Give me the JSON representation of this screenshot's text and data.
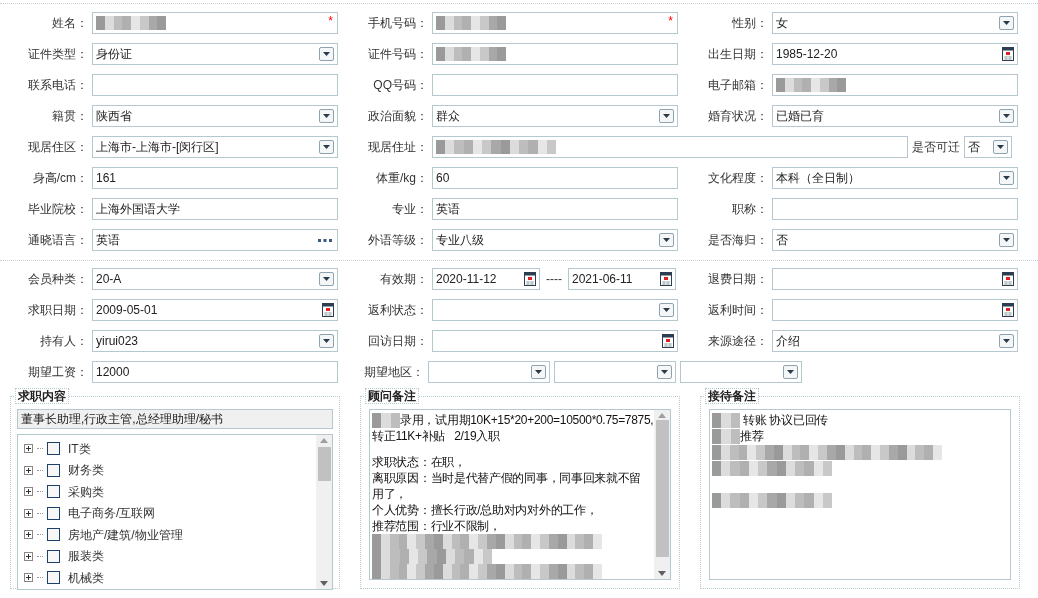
{
  "personal_rows": [
    {
      "fields": [
        {
          "label": "姓名：",
          "kind": "text",
          "required_mark": "*",
          "redacted": true
        },
        {
          "label": "手机号码：",
          "kind": "text",
          "required_mark": "*",
          "redacted": true
        },
        {
          "label": "性别：",
          "kind": "select",
          "value": "女"
        }
      ]
    },
    {
      "fields": [
        {
          "label": "证件类型：",
          "kind": "select",
          "value": "身份证"
        },
        {
          "label": "证件号码：",
          "kind": "text",
          "redacted": true
        },
        {
          "label": "出生日期：",
          "kind": "date",
          "value": "1985-12-20"
        }
      ]
    },
    {
      "fields": [
        {
          "label": "联系电话：",
          "kind": "text"
        },
        {
          "label": "QQ号码：",
          "kind": "text"
        },
        {
          "label": "电子邮箱：",
          "kind": "text",
          "redacted": true
        }
      ]
    },
    {
      "fields": [
        {
          "label": "籍贯：",
          "kind": "select",
          "value": "陕西省"
        },
        {
          "label": "政治面貌：",
          "kind": "select",
          "value": "群众"
        },
        {
          "label": "婚育状况：",
          "kind": "select",
          "value": "已婚已育"
        }
      ]
    },
    {
      "fields": [
        {
          "label": "现居住区：",
          "kind": "select",
          "value": " 上海市-上海市-[闵行区]"
        },
        {
          "label": "现居住址：",
          "kind": "long-text",
          "redacted": true
        },
        {
          "label": "是否可迁",
          "kind": "small-select",
          "value": "否"
        }
      ]
    },
    {
      "fields": [
        {
          "label": "身高/cm：",
          "kind": "text",
          "value": "161"
        },
        {
          "label": "体重/kg：",
          "kind": "text",
          "value": "60"
        },
        {
          "label": "文化程度：",
          "kind": "select",
          "value": "本科（全日制）"
        }
      ]
    },
    {
      "fields": [
        {
          "label": "毕业院校：",
          "kind": "text",
          "value": "上海外国语大学"
        },
        {
          "label": "专业：",
          "kind": "text",
          "value": "英语"
        },
        {
          "label": "职称：",
          "kind": "text"
        }
      ]
    },
    {
      "fields": [
        {
          "label": "通晓语言：",
          "kind": "picker",
          "value": "英语"
        },
        {
          "label": "外语等级：",
          "kind": "select",
          "value": "专业八级"
        },
        {
          "label": "是否海归：",
          "kind": "select",
          "value": "否"
        }
      ]
    }
  ],
  "member_rows": [
    {
      "fields": [
        {
          "label": "会员种类：",
          "kind": "select",
          "value": " 20-A"
        },
        {
          "label": "有效期：",
          "kind": "date-range",
          "value": "2020-11-12",
          "separator": "----",
          "value_to": "2021-06-11"
        },
        {
          "label": "退费日期：",
          "kind": "date"
        }
      ]
    },
    {
      "fields": [
        {
          "label": "求职日期：",
          "kind": "date",
          "value": "2009-05-01"
        },
        {
          "label": "返利状态：",
          "kind": "select"
        },
        {
          "label": "返利时间：",
          "kind": "date"
        }
      ]
    },
    {
      "fields": [
        {
          "label": "持有人：",
          "kind": "select",
          "value": "yirui023"
        },
        {
          "label": "回访日期：",
          "kind": "date"
        },
        {
          "label": "来源途径：",
          "kind": "select",
          "value": "介绍"
        }
      ]
    },
    {
      "fields": [
        {
          "label": "期望工资：",
          "kind": "text",
          "value": "12000"
        },
        {
          "label": "期望地区：",
          "kind": "multi-select",
          "parts": [
            {
              "kind": "select"
            },
            {
              "kind": "select"
            },
            {
              "kind": "select"
            }
          ]
        }
      ]
    }
  ],
  "job_panel": {
    "legend": "求职内容",
    "summary": "董事长助理,行政主管,总经理助理/秘书",
    "tree": [
      {
        "label": "IT类",
        "expanded": false,
        "checked": false
      },
      {
        "label": "财务类",
        "expanded": false,
        "checked": false
      },
      {
        "label": "采购类",
        "expanded": false,
        "checked": false
      },
      {
        "label": "电子商务/互联网",
        "expanded": false,
        "checked": false
      },
      {
        "label": "房地产/建筑/物业管理",
        "expanded": false,
        "checked": false
      },
      {
        "label": "服装类",
        "expanded": false,
        "checked": false
      },
      {
        "label": "机械类",
        "expanded": false,
        "checked": false
      }
    ]
  },
  "consultant_panel": {
    "legend": "顾问备注",
    "lines": [
      {
        "kind": "text",
        "redacted_prefix": true,
        "text": "录用，试用期10K+15*20+200=10500*0.75=7875,"
      },
      {
        "kind": "text",
        "text": "转正11K+补贴   2/19入职"
      },
      {
        "kind": "blank"
      },
      {
        "kind": "text",
        "text": "求职状态：在职，"
      },
      {
        "kind": "text",
        "text": "离职原因：当时是代替产假的同事，同事回来就不留"
      },
      {
        "kind": "text",
        "text": "用了，"
      },
      {
        "kind": "text",
        "text": "个人优势：擅长行政/总助对内对外的工作，"
      },
      {
        "kind": "text",
        "text": "推荐范围：行业不限制，"
      },
      {
        "kind": "redacted"
      },
      {
        "kind": "redacted"
      },
      {
        "kind": "redacted"
      }
    ]
  },
  "reception_panel": {
    "legend": "接待备注",
    "lines": [
      {
        "kind": "text",
        "redacted_prefix": true,
        "text": " 转账 协议已回传"
      },
      {
        "kind": "text",
        "redacted_prefix": true,
        "text": "推荐"
      },
      {
        "kind": "redacted"
      },
      {
        "kind": "redacted"
      },
      {
        "kind": "blank"
      },
      {
        "kind": "redacted"
      }
    ]
  }
}
